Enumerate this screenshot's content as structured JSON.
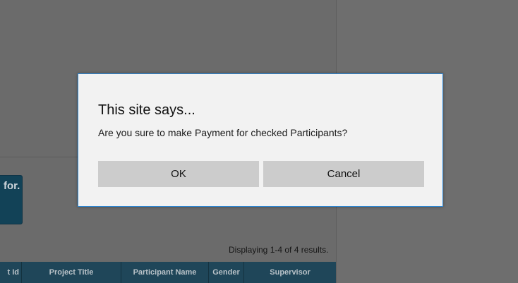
{
  "background": {
    "side_card_text": "for.",
    "results_summary": "Displaying 1-4 of 4 results.",
    "table_columns": [
      "t Id",
      "Project Title",
      "Participant Name",
      "Gender",
      "Supervisor"
    ]
  },
  "dialog": {
    "title": "This site says...",
    "message": "Are you sure to make Payment for checked Participants?",
    "ok_label": "OK",
    "cancel_label": "Cancel"
  },
  "colors": {
    "overlay": "#6b6b6b",
    "dialog_border": "#2b88d8",
    "button": "#cccccc",
    "header": "#1f4659"
  }
}
